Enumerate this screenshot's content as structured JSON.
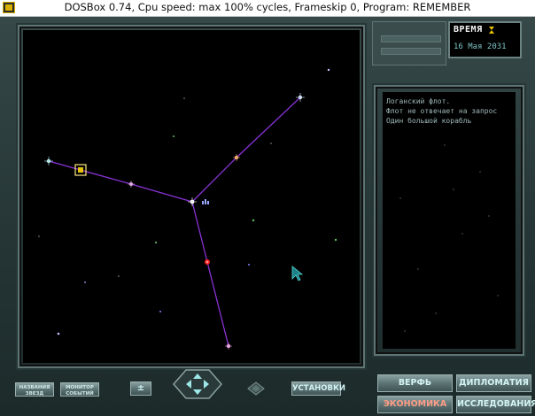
{
  "window": {
    "title": "DOSBox 0.74, Cpu speed: max 100% cycles, Frameskip  0, Program: REMEMBER"
  },
  "time_panel": {
    "label": "ВРЕМЯ",
    "date": "16 Мая 2031"
  },
  "log": {
    "lines": [
      "Логанский флот.",
      "Флот не отвечает на запрос",
      "Один большой корабль"
    ]
  },
  "buttons": {
    "names_stars": "НАЗВАНИЯ ЗВЕЗД",
    "events_monitor": "МОНИТОР СОБЫТИЙ",
    "settings": "УСТАНОВКИ",
    "shipyard": "ВЕРФЬ",
    "diplomacy": "ДИПЛОМАТИЯ",
    "economy": "ЭКОНОМИКА",
    "research": "ИССЛЕДОВАНИЯ"
  },
  "colors": {
    "route": "#8a32d6",
    "enemy_star": "#ff2020",
    "button_text": "#d4f4f4",
    "economy_text": "#ff9c86",
    "date_text": "#7cc4c4"
  },
  "icons": {
    "fleet": "fleet-marker-icon",
    "selection": "selection-cursor-icon",
    "pointer": "mouse-pointer-icon"
  }
}
